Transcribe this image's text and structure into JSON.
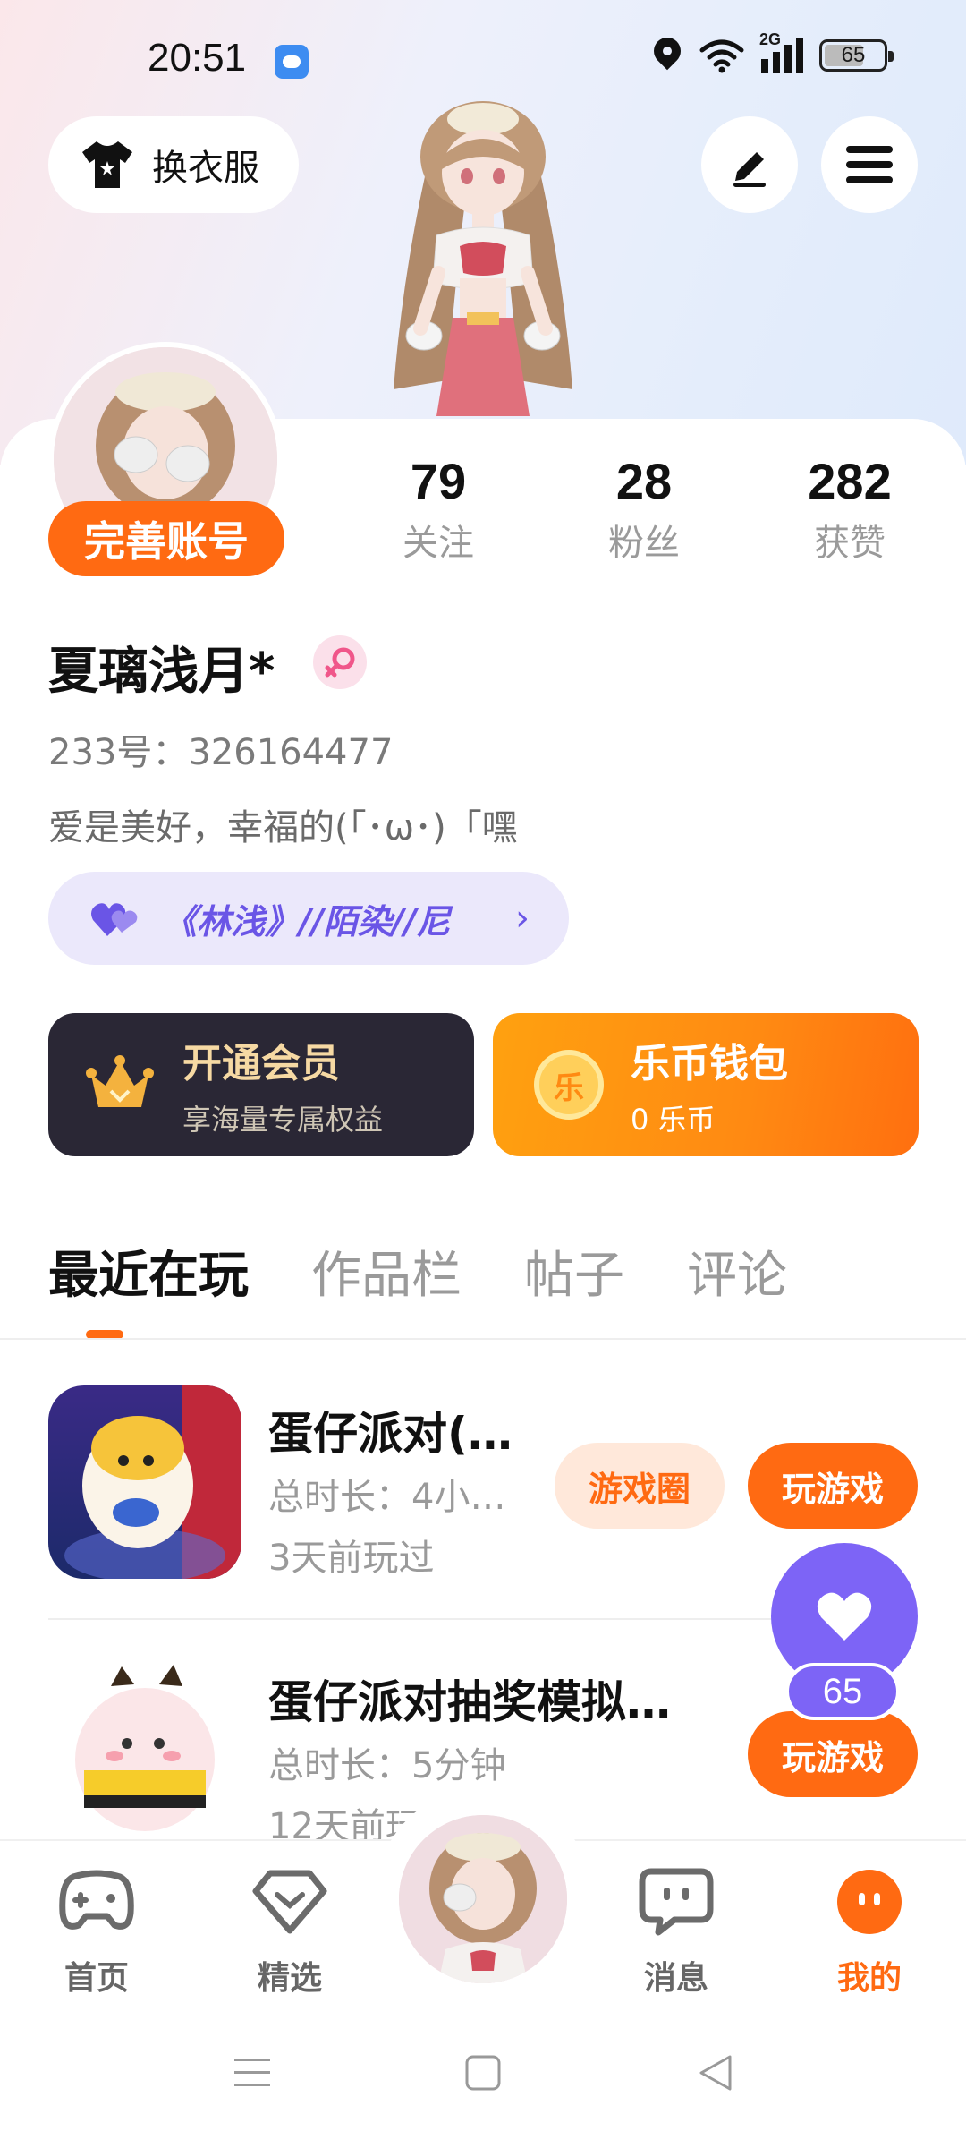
{
  "status_bar": {
    "time": "20:51",
    "network": "2G",
    "battery": "65"
  },
  "header": {
    "outfit_label": "换衣服"
  },
  "profile": {
    "complete_label": "完善账号",
    "stats": [
      {
        "value": "79",
        "label": "关注"
      },
      {
        "value": "28",
        "label": "粉丝"
      },
      {
        "value": "282",
        "label": "获赞"
      }
    ],
    "nickname": "夏璃浅月*",
    "id_line": "233号：326164477",
    "bio": "爱是美好，幸福的(「･ω･)「嘿",
    "guild": "《林浅》//陌染//尼"
  },
  "cards": {
    "vip": {
      "title": "开通会员",
      "subtitle": "享海量专属权益"
    },
    "wallet": {
      "title": "乐币钱包",
      "subtitle": "0 乐币",
      "coin_glyph": "乐"
    }
  },
  "tabs": [
    "最近在玩",
    "作品栏",
    "帖子",
    "评论"
  ],
  "games": [
    {
      "title": "蛋仔派对(…",
      "duration": "总时长：4小…",
      "last_played": "3天前玩过",
      "circle_label": "游戏圈",
      "play_label": "玩游戏"
    },
    {
      "title": "蛋仔派对抽奖模拟…",
      "duration": "总时长：5分钟",
      "last_played": "12天前玩",
      "play_label": "玩游戏"
    }
  ],
  "floating_like": {
    "count": "65"
  },
  "bottom_nav": [
    {
      "label": "首页",
      "icon": "gamepad-icon"
    },
    {
      "label": "精选",
      "icon": "heart-diamond-icon"
    },
    {
      "label": "消息",
      "icon": "chat-icon"
    },
    {
      "label": "我的",
      "icon": "profile-face-icon"
    }
  ],
  "colors": {
    "accent": "#ff6a12",
    "purple": "#7d64f6",
    "vip_dark": "#2a2735"
  }
}
